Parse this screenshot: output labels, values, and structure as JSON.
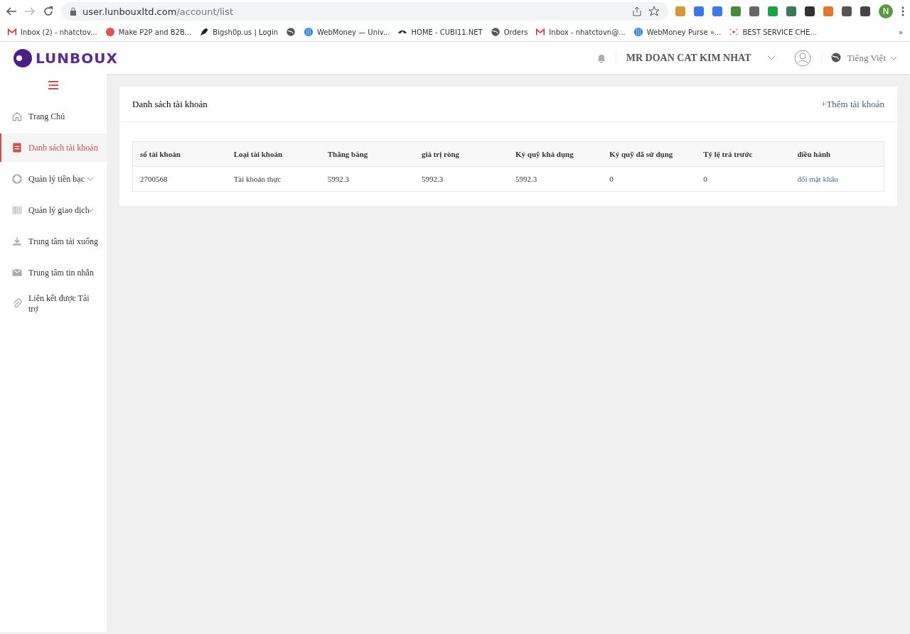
{
  "browser": {
    "url_host": "user.lunbouxltd.com",
    "url_path": "/account/list",
    "profile_initial": "N",
    "bookmarks": [
      {
        "kind": "labeled",
        "label": "Inbox (2) - nhatctov..."
      },
      {
        "label": "Make P2P and B2B..."
      },
      {
        "label": "Bigsh0p.us | Login"
      },
      {
        "kind": "icon_only"
      },
      {
        "label": "WebMoney — Univ..."
      },
      {
        "label": "HOME - CUBI11.NET"
      },
      {
        "label": "Orders"
      },
      {
        "label": "Inbox - nhatctovn@..."
      },
      {
        "label": "WebMoney Purse »..."
      },
      {
        "label": "BEST SERVICE CHE..."
      }
    ],
    "overflow": "»"
  },
  "header": {
    "logo": "LUNBOUX",
    "user_name": "MR DOAN CAT KIM NHAT",
    "language": "Tiếng Việt"
  },
  "sidebar": {
    "items": [
      {
        "label": "Trang Chủ",
        "selected": false,
        "expandable": false
      },
      {
        "label": "Danh sách tài khoản",
        "selected": true,
        "expandable": false
      },
      {
        "label": "Quản lý tiền bạc",
        "selected": false,
        "expandable": true
      },
      {
        "label": "Quản lý giao dịch",
        "selected": false,
        "expandable": true
      },
      {
        "label": "Trung tâm tải xuống",
        "selected": false,
        "expandable": true
      },
      {
        "label": "Trung tâm tin nhắn",
        "selected": false,
        "expandable": false
      },
      {
        "label": "Liên kết được Tài trợ",
        "selected": false,
        "expandable": false
      }
    ]
  },
  "panel": {
    "title": "Danh sách tài khoản",
    "add_link": "+Thêm tài khoản",
    "table": {
      "columns": [
        "số tài khoản",
        "Loại tài khoản",
        "Thăng bằng",
        "giá trị ròng",
        "Ký quỹ khả dụng",
        "Ký quỹ đã sử dụng",
        "Tỷ lệ trả trước",
        "điều hành"
      ],
      "rows": [
        {
          "cells": [
            "2700568",
            "Tài khoản thực",
            "5992.3",
            "5992.3",
            "5992.3",
            "0",
            "0"
          ],
          "action": "đổi mật khẩu"
        }
      ]
    }
  }
}
